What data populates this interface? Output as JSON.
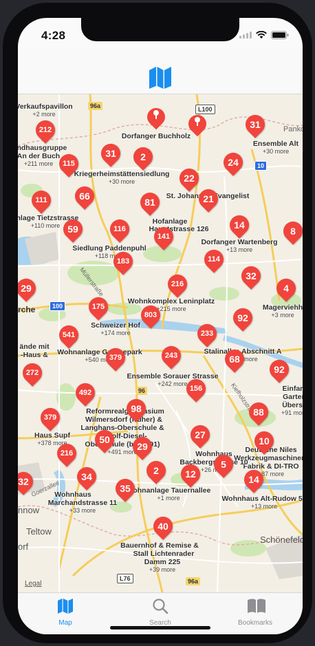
{
  "status": {
    "time": "4:28"
  },
  "tabs": [
    {
      "label": "Map",
      "icon": "map-icon",
      "active": true
    },
    {
      "label": "Search",
      "icon": "search-icon",
      "active": false
    },
    {
      "label": "Bookmarks",
      "icon": "bookmarks-icon",
      "active": false
    }
  ],
  "map": {
    "legal": "Legal",
    "places": [
      "Pankow",
      "Teltow",
      "Schönefeld",
      "rche",
      "orf",
      "nnow"
    ],
    "road_shields": [
      "96a",
      "L100",
      "10",
      "100",
      "96",
      "L76",
      "96a"
    ],
    "street_labels": [
      "Müllerstraße",
      "Kiefholzstraße",
      "Goerzallee"
    ],
    "clusters": [
      "212",
      "31",
      "2",
      "31",
      "115",
      "24",
      "22",
      "111",
      "66",
      "81",
      "21",
      "59",
      "116",
      "141",
      "14",
      "8",
      "183",
      "114",
      "32",
      "29",
      "216",
      "4",
      "175",
      "803",
      "92",
      "541",
      "233",
      "379",
      "243",
      "68",
      "272",
      "92",
      "492",
      "156",
      "98",
      "88",
      "379",
      "50",
      "27",
      "29",
      "10",
      "216",
      "2",
      "12",
      "5",
      "14",
      "34",
      "35",
      "32",
      "40"
    ],
    "places_labels": [
      {
        "title": "Verkaufspavillon",
        "sub": "+2 more"
      },
      {
        "title": "Dorfanger Buchholz",
        "sub": ""
      },
      {
        "title": "andhausgruppe",
        "sub": ""
      },
      {
        "title": "An der Buch",
        "sub": "+211 more"
      },
      {
        "title": "Ensemble Alt",
        "sub": "+30 more"
      },
      {
        "title": "Kriegerheimstättensiedlung",
        "sub": "+30 more"
      },
      {
        "title": "St. Johannes Evangelist",
        "sub": ""
      },
      {
        "title": "anlage Tietzstrasse",
        "sub": "+110 more"
      },
      {
        "title": "Hofanlage",
        "sub": ""
      },
      {
        "title": "Hauptstrasse 126",
        "sub": ""
      },
      {
        "title": "Dorfanger Wartenberg",
        "sub": "+13 more"
      },
      {
        "title": "Siedlung Paddenpuhl",
        "sub": "+118 more"
      },
      {
        "title": "Wohnkomplex Leninplatz",
        "sub": "+215 more"
      },
      {
        "title": "Magerviehh",
        "sub": "+3 more"
      },
      {
        "title": "Schweizer Hof",
        "sub": "+174 more"
      },
      {
        "title": "Wohnanlage Goethepark",
        "sub": "+540 more"
      },
      {
        "title": "Stalinallee Abschnitt A",
        "sub": "+232 more"
      },
      {
        "title": "ände mit",
        "sub": ""
      },
      {
        "title": "-Haus &",
        "sub": ""
      },
      {
        "title": "Ensemble Sorauer Strasse",
        "sub": "+242 more"
      },
      {
        "title": "Reformrealgymnasium",
        "sub": ""
      },
      {
        "title": "Wilmersdorf (früher) &",
        "sub": ""
      },
      {
        "title": "Langhans-Oberschule &",
        "sub": ""
      },
      {
        "title": "Rudolf-Diesel-",
        "sub": ""
      },
      {
        "title": "Oberschule (bis 1991)",
        "sub": "+491 more"
      },
      {
        "title": "Haus Supf",
        "sub": "+378 more"
      },
      {
        "title": "Deutsche Niles",
        "sub": ""
      },
      {
        "title": "Werkzeugmaschinen-",
        "sub": ""
      },
      {
        "title": "Fabrik & DI-TRO",
        "sub": "+87 more"
      },
      {
        "title": "Wohnhaus",
        "sub": ""
      },
      {
        "title": "Backbergstrasse 10",
        "sub": "+26 more"
      },
      {
        "title": "Wohnanlage Tauernallee",
        "sub": "+1 more"
      },
      {
        "title": "Wohnhaus Alt-Rudow 50",
        "sub": "+13 more"
      },
      {
        "title": "Wohnhaus",
        "sub": ""
      },
      {
        "title": "Marchandstrasse 11",
        "sub": "+33 more"
      },
      {
        "title": "Einfam",
        "sub": ""
      },
      {
        "title": "Garten",
        "sub": ""
      },
      {
        "title": "Überse",
        "sub": "+91 more"
      },
      {
        "title": "Bauernhof & Remise &",
        "sub": ""
      },
      {
        "title": "Stall Lichtenrader",
        "sub": ""
      },
      {
        "title": "Damm 225",
        "sub": "+39 more"
      }
    ]
  }
}
